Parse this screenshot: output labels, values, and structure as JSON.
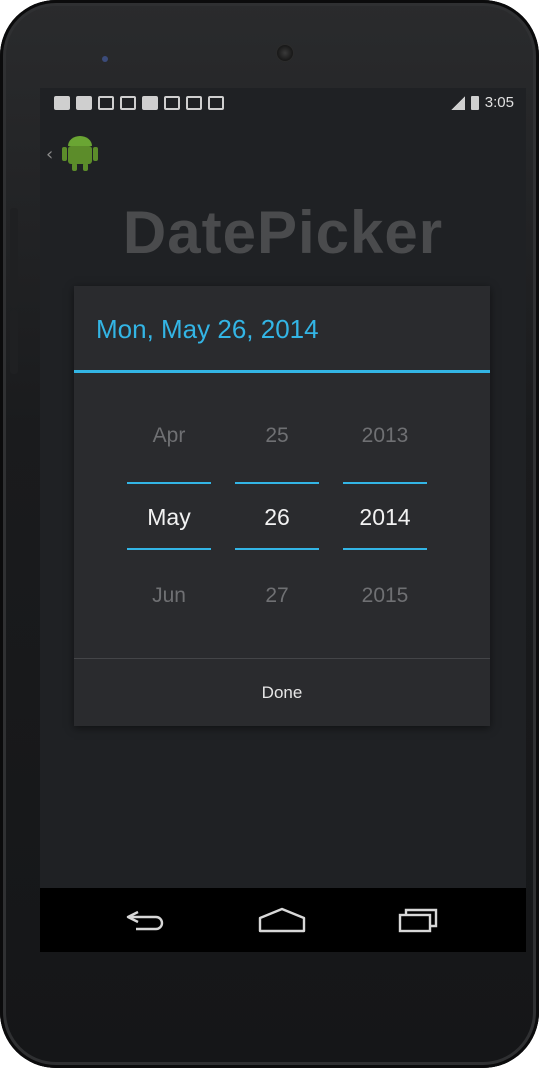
{
  "statusbar": {
    "time": "3:05"
  },
  "app": {
    "heading": "DatePicker"
  },
  "dialog": {
    "title": "Mon, May 26, 2014",
    "month": {
      "prev": "Apr",
      "current": "May",
      "next": "Jun"
    },
    "day": {
      "prev": "25",
      "current": "26",
      "next": "27"
    },
    "year": {
      "prev": "2013",
      "current": "2014",
      "next": "2015"
    },
    "done_label": "Done"
  },
  "colors": {
    "accent": "#33b5e5",
    "dialog_bg": "#2a2b2e",
    "heading": "#4a4b4d"
  },
  "icons": {
    "navbar": [
      "back-icon",
      "home-icon",
      "recent-apps-icon"
    ],
    "statusbar": [
      "chat-icon",
      "chat-icon",
      "image-icon",
      "gmail-icon",
      "facebook-icon",
      "person-add-icon",
      "play-store-icon",
      "checkbox-icon",
      "signal-icon",
      "battery-icon"
    ],
    "actionbar": [
      "back-chevron-icon",
      "android-app-icon"
    ]
  }
}
